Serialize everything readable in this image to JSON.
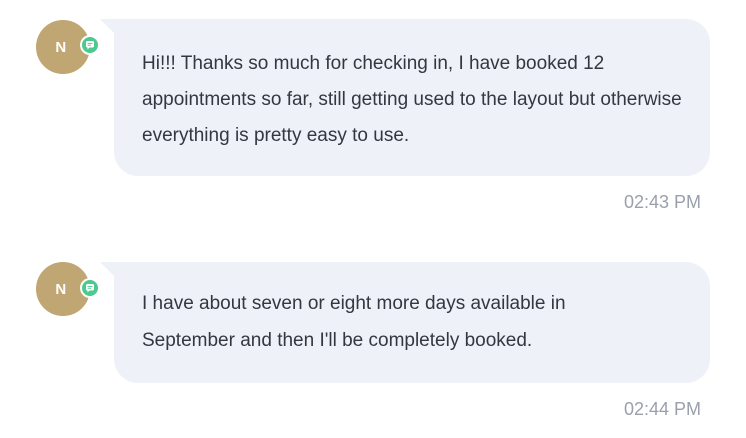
{
  "messages": [
    {
      "avatar_initial": "N",
      "badge_icon": "chat-bubble-icon",
      "text": "Hi!!! Thanks so much for checking in, I have booked 12 appointments so far, still getting used to the layout but otherwise everything is pretty easy to use.",
      "time": "02:43 PM"
    },
    {
      "avatar_initial": "N",
      "badge_icon": "chat-bubble-icon",
      "text": "I have about seven or eight more days available in September and then I'll be completely booked.",
      "time": "02:44 PM"
    }
  ],
  "colors": {
    "avatar": "#bfa672",
    "badge": "#4cc98f",
    "bubble": "#eef1f8",
    "text": "#333840",
    "timestamp": "#9aa0ab"
  }
}
